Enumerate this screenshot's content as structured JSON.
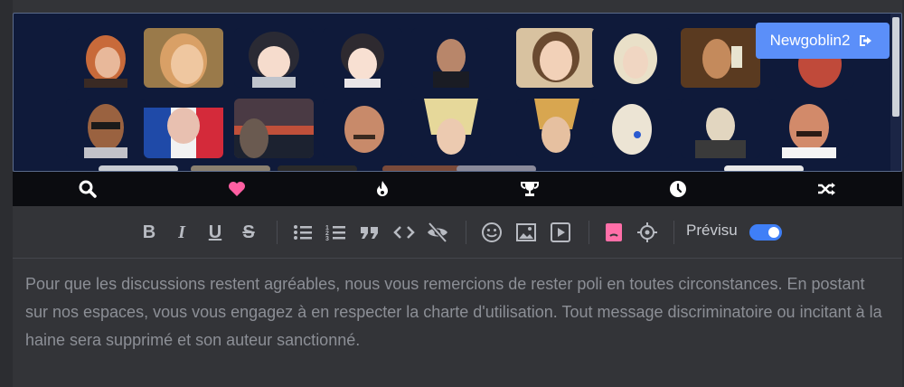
{
  "user": {
    "name": "Newgoblin2",
    "logout_icon": "sign-out-icon"
  },
  "categories": [
    {
      "name": "search",
      "icon": "search-icon"
    },
    {
      "name": "favorites",
      "icon": "heart-icon",
      "color": "#ff5fa2"
    },
    {
      "name": "trending",
      "icon": "flame-icon"
    },
    {
      "name": "top",
      "icon": "trophy-icon"
    },
    {
      "name": "recent",
      "icon": "clock-icon"
    },
    {
      "name": "random",
      "icon": "shuffle-icon"
    }
  ],
  "toolbar": {
    "preview_label": "Prévisu",
    "preview_on": true,
    "accent_pink": "#ff6fa8"
  },
  "editor": {
    "placeholder": "Pour que les discussions restent agréables, nous vous remercions de rester poli en toutes circonstances. En postant sur nos espaces, vous vous engagez à en respecter la charte d'utilisation. Tout message discriminatoire ou incitant à la haine sera supprimé et son auteur sanctionné."
  }
}
